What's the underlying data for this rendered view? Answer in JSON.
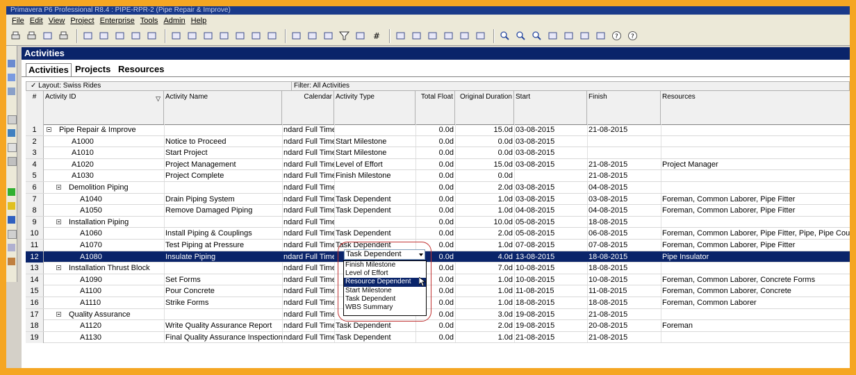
{
  "window": {
    "title": "Primavera P6 Professional R8.4 : PIPE-RPR-2 (Pipe Repair & Improve)"
  },
  "menu": [
    "File",
    "Edit",
    "View",
    "Project",
    "Enterprise",
    "Tools",
    "Admin",
    "Help"
  ],
  "panel": {
    "title": "Activities"
  },
  "tabs": [
    "Activities",
    "Projects",
    "Resources"
  ],
  "layout": {
    "label": "Layout: Swiss Rides",
    "filter": "Filter: All Activities"
  },
  "columns": {
    "num": "#",
    "activity_id": "Activity ID",
    "activity_name": "Activity Name",
    "calendar": "Calendar",
    "activity_type": "Activity Type",
    "total_float": "Total Float",
    "original_duration": "Original Duration",
    "start": "Start",
    "finish": "Finish",
    "resources": "Resources"
  },
  "rows": [
    {
      "num": "1",
      "level": 0,
      "group": true,
      "id": "Pipe Repair & Improve",
      "name": "",
      "cal": "ndard Full Time",
      "type": "",
      "float": "0.0d",
      "dur": "15.0d",
      "start": "03-08-2015",
      "finish": "21-08-2015",
      "res": ""
    },
    {
      "num": "2",
      "level": 2,
      "id": "A1000",
      "name": "Notice to Proceed",
      "cal": "ndard Full Time",
      "type": "Start Milestone",
      "float": "0.0d",
      "dur": "0.0d",
      "start": "03-08-2015",
      "finish": "",
      "res": ""
    },
    {
      "num": "3",
      "level": 2,
      "id": "A1010",
      "name": "Start Project",
      "cal": "ndard Full Time",
      "type": "Start Milestone",
      "float": "0.0d",
      "dur": "0.0d",
      "start": "03-08-2015",
      "finish": "",
      "res": ""
    },
    {
      "num": "4",
      "level": 2,
      "id": "A1020",
      "name": "Project Management",
      "cal": "ndard Full Time",
      "type": "Level of Effort",
      "float": "0.0d",
      "dur": "15.0d",
      "start": "03-08-2015",
      "finish": "21-08-2015",
      "res": "Project Manager"
    },
    {
      "num": "5",
      "level": 2,
      "id": "A1030",
      "name": "Project Complete",
      "cal": "ndard Full Time",
      "type": "Finish Milestone",
      "float": "0.0d",
      "dur": "0.0d",
      "start": "",
      "finish": "21-08-2015",
      "res": ""
    },
    {
      "num": "6",
      "level": 1,
      "group": true,
      "id": "Demolition Piping",
      "name": "",
      "cal": "ndard Full Time",
      "type": "",
      "float": "0.0d",
      "dur": "2.0d",
      "start": "03-08-2015",
      "finish": "04-08-2015",
      "res": ""
    },
    {
      "num": "7",
      "level": 3,
      "id": "A1040",
      "name": "Drain Piping System",
      "cal": "ndard Full Time",
      "type": "Task Dependent",
      "float": "0.0d",
      "dur": "1.0d",
      "start": "03-08-2015",
      "finish": "03-08-2015",
      "res": "Foreman, Common Laborer, Pipe Fitter"
    },
    {
      "num": "8",
      "level": 3,
      "id": "A1050",
      "name": "Remove Damaged Piping",
      "cal": "ndard Full Time",
      "type": "Task Dependent",
      "float": "0.0d",
      "dur": "1.0d",
      "start": "04-08-2015",
      "finish": "04-08-2015",
      "res": "Foreman, Common Laborer, Pipe Fitter"
    },
    {
      "num": "9",
      "level": 1,
      "group": true,
      "id": "Installation Piping",
      "name": "",
      "cal": "ndard Full Time",
      "type": "",
      "float": "0.0d",
      "dur": "10.0d",
      "start": "05-08-2015",
      "finish": "18-08-2015",
      "res": ""
    },
    {
      "num": "10",
      "level": 3,
      "id": "A1060",
      "name": "Install Piping & Couplings",
      "cal": "ndard Full Time",
      "type": "Task Dependent",
      "float": "0.0d",
      "dur": "2.0d",
      "start": "05-08-2015",
      "finish": "06-08-2015",
      "res": "Foreman, Common Laborer, Pipe Fitter, Pipe, Pipe Coupling"
    },
    {
      "num": "11",
      "level": 3,
      "id": "A1070",
      "name": "Test Piping at Pressure",
      "cal": "ndard Full Time",
      "type": "Task Dependent",
      "float": "0.0d",
      "dur": "1.0d",
      "start": "07-08-2015",
      "finish": "07-08-2015",
      "res": "Foreman, Common Laborer, Pipe Fitter"
    },
    {
      "num": "12",
      "level": 3,
      "selected": true,
      "id": "A1080",
      "name": "Insulate Piping",
      "cal": "ndard Full Time",
      "type": "",
      "float": "0.0d",
      "dur": "4.0d",
      "start": "13-08-2015",
      "finish": "18-08-2015",
      "res": "Pipe Insulator"
    },
    {
      "num": "13",
      "level": 1,
      "group": true,
      "id": "Installation Thrust Block",
      "name": "",
      "cal": "ndard Full Time",
      "type": "",
      "float": "0.0d",
      "dur": "7.0d",
      "start": "10-08-2015",
      "finish": "18-08-2015",
      "res": ""
    },
    {
      "num": "14",
      "level": 3,
      "id": "A1090",
      "name": "Set Forms",
      "cal": "ndard Full Time",
      "type": "",
      "float": "0.0d",
      "dur": "1.0d",
      "start": "10-08-2015",
      "finish": "10-08-2015",
      "res": "Foreman, Common Laborer, Concrete Forms"
    },
    {
      "num": "15",
      "level": 3,
      "id": "A1100",
      "name": "Pour Concrete",
      "cal": "ndard Full Time",
      "type": "",
      "float": "0.0d",
      "dur": "1.0d",
      "start": "11-08-2015",
      "finish": "11-08-2015",
      "res": "Foreman, Common Laborer, Concrete"
    },
    {
      "num": "16",
      "level": 3,
      "id": "A1110",
      "name": "Strike Forms",
      "cal": "ndard Full Time",
      "type": "",
      "float": "0.0d",
      "dur": "1.0d",
      "start": "18-08-2015",
      "finish": "18-08-2015",
      "res": "Foreman, Common Laborer"
    },
    {
      "num": "17",
      "level": 1,
      "group": true,
      "id": "Quality Assurance",
      "name": "",
      "cal": "ndard Full Time",
      "type": "",
      "float": "0.0d",
      "dur": "3.0d",
      "start": "19-08-2015",
      "finish": "21-08-2015",
      "res": ""
    },
    {
      "num": "18",
      "level": 3,
      "id": "A1120",
      "name": "Write Quality Assurance Report",
      "cal": "ndard Full Time",
      "type": "Task Dependent",
      "float": "0.0d",
      "dur": "2.0d",
      "start": "19-08-2015",
      "finish": "20-08-2015",
      "res": "Foreman"
    },
    {
      "num": "19",
      "level": 3,
      "id": "A1130",
      "name": "Final Quality Assurance Inspection",
      "cal": "ndard Full Time",
      "type": "Task Dependent",
      "float": "0.0d",
      "dur": "1.0d",
      "start": "21-08-2015",
      "finish": "21-08-2015",
      "res": ""
    }
  ],
  "dropdown": {
    "value": "Task Dependent",
    "options": [
      "Finish Milestone",
      "Level of Effort",
      "Resource Dependent",
      "Start Milestone",
      "Task Dependent",
      "WBS Summary"
    ],
    "highlighted": "Resource Dependent"
  },
  "colors": {
    "selection": "#0a246a",
    "panel_header": "#0a246a",
    "frame": "#f5a623",
    "annotation_circle": "#c03030"
  }
}
